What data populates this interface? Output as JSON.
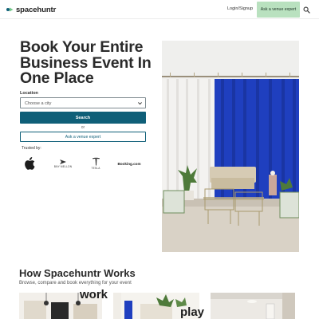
{
  "header": {
    "logo_text": "spacehuntr",
    "login_label": "Login/Signup",
    "expert_button_label": "Ask a venue expert",
    "search_icon": "search-icon"
  },
  "hero": {
    "title": "Book Your Entire Business Event In One Place",
    "location_label": "Location",
    "city_select": {
      "selected": "Choose a city",
      "icon": "chevron-down-icon"
    },
    "search_button_label": "Search",
    "or_text": "or",
    "ask_button_label": "Ask a venue expert",
    "trusted_label": "Trusted by:",
    "brands": {
      "apple": {
        "icon": "apple-logo"
      },
      "bny": {
        "text": "BNY MELLON",
        "icon": "bny-mellon-logo"
      },
      "tesla": {
        "text": "TESLA",
        "icon": "tesla-logo"
      },
      "booking": {
        "text": "Booking.com"
      }
    },
    "image": "event-venue-photo"
  },
  "how_it_works": {
    "title": "How Spacehuntr Works",
    "subtitle": "Browse, compare and book everything for your event",
    "cards": [
      {
        "word": "work",
        "image": "workspace-photo"
      },
      {
        "word": "play",
        "image": "event-space-photo"
      },
      {
        "word": "",
        "image": "room-photo"
      }
    ]
  },
  "colors": {
    "primary": "#0f5f78",
    "accent_green": "#b9e1bf",
    "curtain_blue": "#1f3fbf"
  }
}
